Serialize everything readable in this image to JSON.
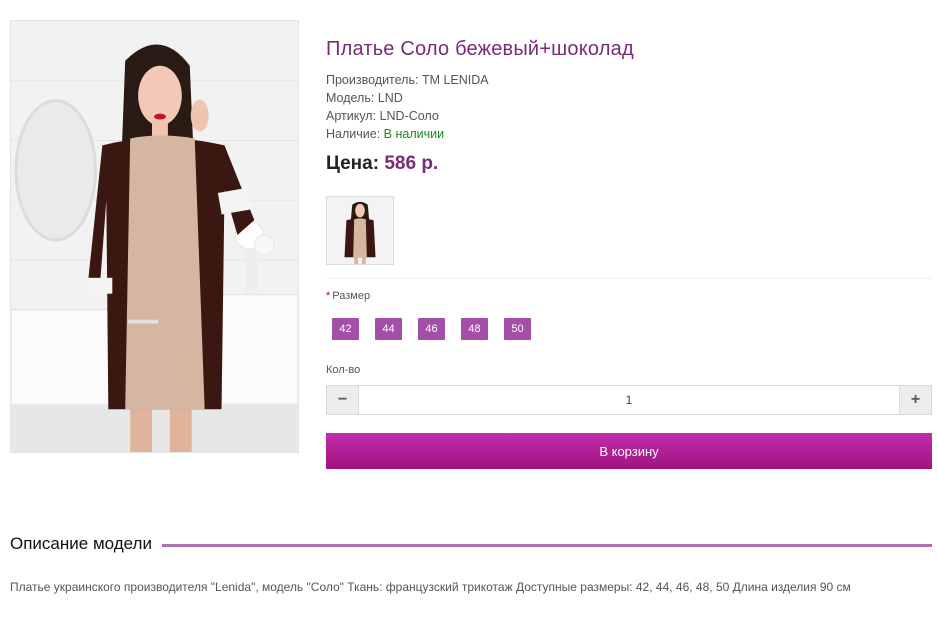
{
  "product": {
    "title": "Платье Соло бежевый+шоколад",
    "manufacturer_label": "Производитель:",
    "manufacturer_value": "ТМ LENIDA",
    "model_label": "Модель:",
    "model_value": "LND",
    "sku_label": "Артикул:",
    "sku_value": "LND-Соло",
    "availability_label": "Наличие:",
    "availability_value": "В наличии",
    "price_label": "Цена:",
    "price_value": "586 р."
  },
  "options": {
    "size_label": "Размер",
    "required_mark": "*",
    "sizes": [
      "42",
      "44",
      "46",
      "48",
      "50"
    ]
  },
  "quantity": {
    "label": "Кол-во",
    "value": "1",
    "minus": "−",
    "plus": "+"
  },
  "cart": {
    "button_label": "В корзину"
  },
  "description": {
    "heading": "Описание модели",
    "text": "Платье украинского производителя \"Lenida\", модель \"Соло\" Ткань: французский трикотаж Доступные размеры: 42, 44, 46, 48, 50 Длина изделия 90 см"
  },
  "colors": {
    "accent": "#7a2b78",
    "size_button": "#a34fa8",
    "cart_button": "#b01f98",
    "divider": "#b070b5",
    "in_stock": "#1a8a1a"
  }
}
